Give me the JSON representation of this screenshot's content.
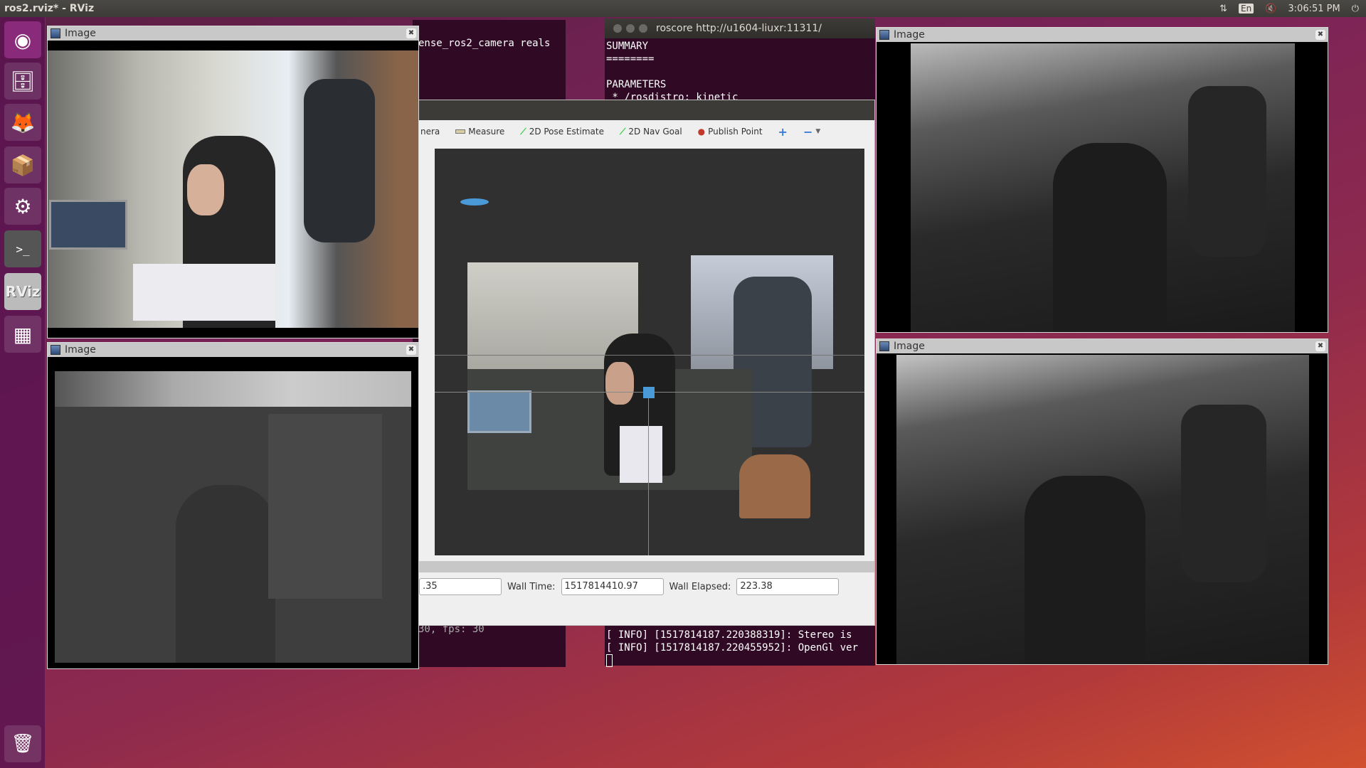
{
  "top_panel": {
    "title": "ros2.rviz* - RViz",
    "indicators": {
      "network_icon": "⇅",
      "keyboard_layout": "En",
      "volume_icon": "🔇",
      "clock": "3:06:51 PM",
      "power_icon": "⏻"
    }
  },
  "launcher": {
    "items": [
      {
        "name": "ubuntu-dash",
        "glyph": "◉"
      },
      {
        "name": "files",
        "glyph": "🗄"
      },
      {
        "name": "firefox",
        "glyph": "🦊"
      },
      {
        "name": "software-install",
        "glyph": "📦"
      },
      {
        "name": "system-settings",
        "glyph": "⚙"
      },
      {
        "name": "terminal",
        "glyph": ">_"
      },
      {
        "name": "rviz",
        "glyph": "RViz"
      },
      {
        "name": "workspace-switcher",
        "glyph": "▦"
      },
      {
        "name": "trash",
        "glyph": "🗑"
      }
    ]
  },
  "terminal_left": {
    "line1": "ense_ros2_camera reals",
    "line_bottom": "30, fps: 30"
  },
  "terminal_roscore": {
    "title": "roscore http://u1604-liuxr:11311/",
    "lines": [
      "SUMMARY",
      "========",
      "",
      "PARAMETERS",
      " * /rosdistro: kinetic"
    ],
    "log_lines": [
      "[ INFO] [1517814187.220388319]: Stereo is",
      "[ INFO] [1517814187.220455952]: OpenGl ver"
    ]
  },
  "image_windows": [
    {
      "title": "Image",
      "kind": "color"
    },
    {
      "title": "Image",
      "kind": "depth"
    },
    {
      "title": "Image",
      "kind": "infrared-1"
    },
    {
      "title": "Image",
      "kind": "infrared-2"
    }
  ],
  "rviz": {
    "toolbar": {
      "camera_partial": "nera",
      "measure": "Measure",
      "pose_estimate": "2D Pose Estimate",
      "nav_goal": "2D Nav Goal",
      "publish_point": "Publish Point",
      "add_icon": "+",
      "remove_icon": "−"
    },
    "time": {
      "ros_elapsed_partial": ".35",
      "wall_time_label": "Wall Time:",
      "wall_time": "1517814410.97",
      "wall_elapsed_label": "Wall Elapsed:",
      "wall_elapsed": "223.38"
    }
  }
}
